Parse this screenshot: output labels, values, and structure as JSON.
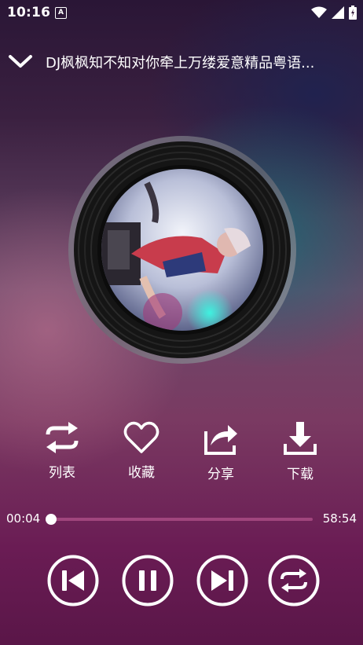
{
  "status_bar": {
    "time": "10:16",
    "notification_icon": "a-icon",
    "icons": [
      "wifi-icon",
      "signal-icon",
      "battery-icon"
    ]
  },
  "header": {
    "back_icon": "chevron-down-icon",
    "title": "DJ枫枫知不知对你牵上万缕爱意精品粤语..."
  },
  "album": {
    "art": "vinyl-disc-with-cover"
  },
  "actions": [
    {
      "icon": "repeat-list-icon",
      "label": "列表"
    },
    {
      "icon": "heart-icon",
      "label": "收藏"
    },
    {
      "icon": "share-icon",
      "label": "分享"
    },
    {
      "icon": "download-icon",
      "label": "下载"
    }
  ],
  "progress": {
    "current": "00:04",
    "total": "58:54",
    "fraction": 0.0
  },
  "controls": [
    {
      "icon": "previous-icon"
    },
    {
      "icon": "pause-icon"
    },
    {
      "icon": "next-icon"
    },
    {
      "icon": "repeat-mode-icon"
    }
  ],
  "colors": {
    "accent": "#a0457d",
    "background_top": "#2a1636",
    "background_bottom": "#5a1648"
  }
}
